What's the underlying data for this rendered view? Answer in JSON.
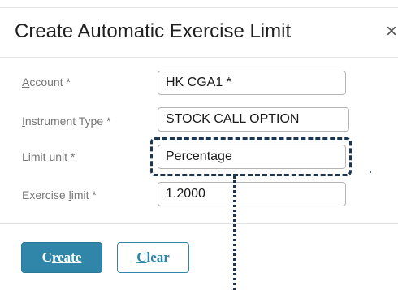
{
  "dialog": {
    "title": "Create Automatic Exercise Limit",
    "close_glyph": "×"
  },
  "form": {
    "account": {
      "label_mnemonic": "A",
      "label_rest": "ccount *",
      "value": "HK CGA1 *"
    },
    "instrument_type": {
      "label_mnemonic": "I",
      "label_rest": "nstrument Type *",
      "value": "STOCK CALL OPTION"
    },
    "limit_unit": {
      "label_before": "Limit ",
      "label_mnemonic": "u",
      "label_rest": "nit *",
      "value": "Percentage"
    },
    "exercise_limit": {
      "label_before": "Exercise ",
      "label_mnemonic": "l",
      "label_rest": "imit *",
      "value": "1.2000"
    }
  },
  "buttons": {
    "create": {
      "mnemonic": "C",
      "rest": "reate"
    },
    "clear": {
      "mnemonic": "C",
      "rest": "lear"
    }
  },
  "colors": {
    "primary": "#2f86a8",
    "callout": "#1b3654"
  }
}
